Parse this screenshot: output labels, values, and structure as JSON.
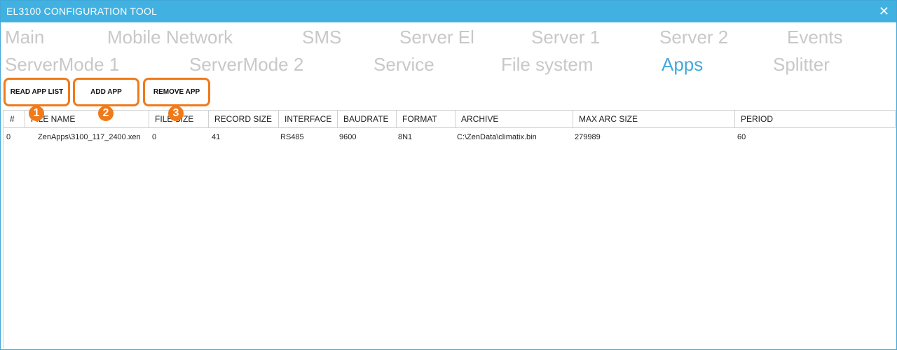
{
  "window": {
    "title": "EL3100 CONFIGURATION TOOL",
    "close_glyph": "✕"
  },
  "tabs": [
    {
      "label": "Main"
    },
    {
      "label": "Mobile Network"
    },
    {
      "label": "SMS"
    },
    {
      "label": "Server El"
    },
    {
      "label": "Server 1"
    },
    {
      "label": "Server 2"
    },
    {
      "label": "Events"
    },
    {
      "label": "ServerMode 1"
    },
    {
      "label": "ServerMode 2"
    },
    {
      "label": "Service"
    },
    {
      "label": "File system"
    },
    {
      "label": "Apps"
    },
    {
      "label": "Splitter"
    }
  ],
  "active_tab": "Apps",
  "accent_color": "#45a9dc",
  "highlight_color": "#f07a1a",
  "toolbar": {
    "read_app_list": "READ APP LIST",
    "add_app": "ADD APP",
    "remove_app": "REMOVE APP"
  },
  "badges": [
    "1",
    "2",
    "3"
  ],
  "table": {
    "columns": [
      "#",
      "FILE NAME",
      "FILE SIZE",
      "RECORD SIZE",
      "INTERFACE",
      "BAUDRATE",
      "FORMAT",
      "ARCHIVE",
      "MAX ARC SIZE",
      "PERIOD"
    ],
    "rows": [
      [
        "0",
        "ZenApps\\3100_117_2400.xen",
        "0",
        "41",
        "RS485",
        "9600",
        "8N1",
        "C:\\ZenData\\climatix.bin",
        "279989",
        "60"
      ]
    ]
  }
}
